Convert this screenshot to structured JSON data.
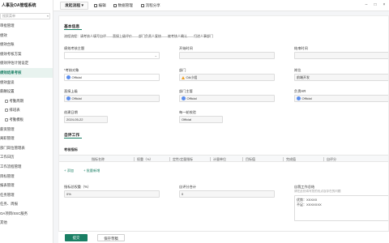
{
  "app": {
    "title": "人事及OA管理系统"
  },
  "sidebar": {
    "search_placeholder": "搜索菜单",
    "items": [
      {
        "label": "审批管理",
        "level": "top"
      },
      {
        "label": "绩效",
        "level": "top"
      },
      {
        "label": "绩效台账",
        "level": "top"
      },
      {
        "label": "绩效考核方案",
        "level": "top"
      },
      {
        "label": "绩效评估计划设定",
        "level": "top"
      },
      {
        "label": "绩效结果考核",
        "level": "top",
        "active": true
      },
      {
        "label": "绩效面谈",
        "level": "top"
      },
      {
        "label": "薪酬设置",
        "level": "top"
      },
      {
        "label": "考勤周期",
        "level": "sub"
      },
      {
        "label": "排班表",
        "level": "sub"
      },
      {
        "label": "考勤模板",
        "level": "sub"
      },
      {
        "label": "薪资管理",
        "level": "top"
      },
      {
        "label": "离职管理",
        "level": "top"
      },
      {
        "label": "部门岗位管理表",
        "level": "top"
      },
      {
        "label": "工作日历",
        "level": "top"
      },
      {
        "label": "工作流程管理",
        "level": "top"
      },
      {
        "label": "目标管理",
        "level": "top"
      },
      {
        "label": "报表管理",
        "level": "top"
      },
      {
        "label": "任务管理",
        "level": "top"
      },
      {
        "label": "任务、周报",
        "level": "top"
      },
      {
        "label": "OA项目/SSC服务",
        "level": "top"
      },
      {
        "label": "其他",
        "level": "top"
      }
    ]
  },
  "topbar": {
    "tab_label": "发起流程",
    "actions": [
      {
        "label": "编辑",
        "icon": "edit-icon"
      },
      {
        "label": "数据管理",
        "icon": "database-icon"
      },
      {
        "label": "流程分享",
        "icon": "share-icon"
      }
    ],
    "controls": {
      "minimize": "–",
      "maximize": "□",
      "close": "×"
    }
  },
  "form": {
    "basic_section": "基本信息",
    "process_flow": "流程流程：请考核人填写自评——直接上级评价——部门负责人复核——被考核人确认——归进人事部门",
    "fields": {
      "plan_label": "绩效考核主题",
      "plan_value": "",
      "start_label": "开始时间",
      "start_value": "",
      "end_label": "结束时间",
      "end_value": "",
      "assessee_label": "*考核对象",
      "assessee_value": "Official",
      "dept_label": "部门",
      "dept_value": "OA小组",
      "position_label": "岗位",
      "position_value": "前端开发",
      "direct_label": "直接上级",
      "direct_value": "Official",
      "dept_head_label": "部门主管",
      "dept_head_value": "Official",
      "hr_label": "负责HR",
      "hr_value": "Official",
      "created_label": "创建日期",
      "created_value": "2024-05-22",
      "reviewer_label": "每一轮校验",
      "reviewer_value": "Official"
    },
    "eval_section": "自评工作",
    "indicator_label": "考核指标",
    "table_headers": [
      "指标名称",
      "权重（%）",
      "定性/定量指标",
      "计量单位",
      "目标值",
      "完成值",
      "自评分"
    ],
    "add_label": "+ 添加",
    "import_label": "+ 批量新增",
    "weight_total_label": "指标总权重（%）",
    "weight_total_value": "0%",
    "self_total_label": "自评分合计",
    "self_total_value": "0",
    "summary_label": "自我工作总结",
    "summary_hint": "请在此处填写您的优点及存在的问题",
    "summary_good_label": "优势：",
    "summary_good_value": "XXXXX",
    "summary_bad_label": "不足：",
    "summary_bad_value": "XXXXXXX"
  },
  "footer": {
    "submit_label": "提交",
    "draft_label": "保存草稿"
  },
  "colors": {
    "accent": "#1a7f64",
    "avatar": "#5a8dee",
    "warn": "#f0a020"
  }
}
